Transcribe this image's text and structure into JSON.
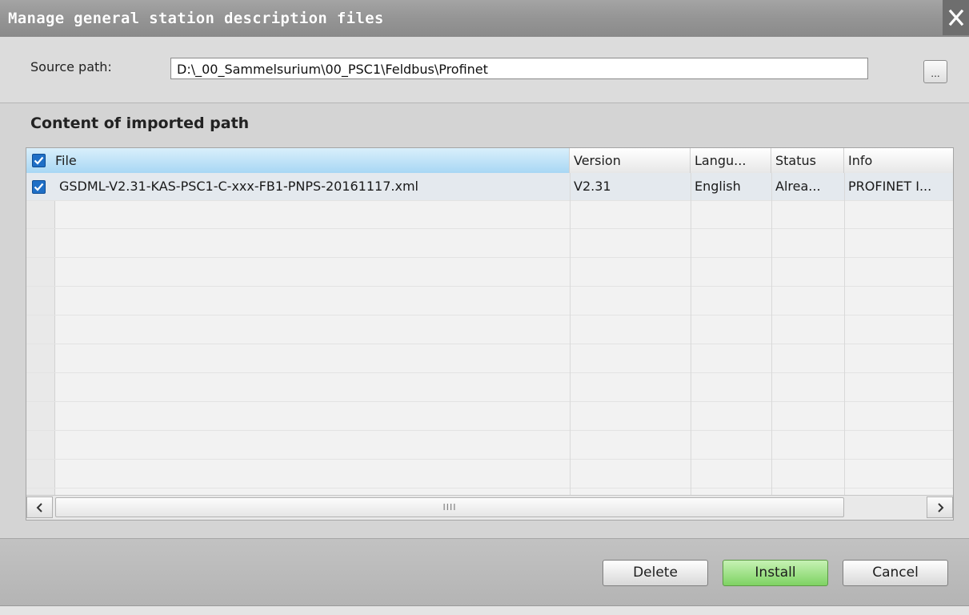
{
  "window": {
    "title": "Manage general station description files"
  },
  "source": {
    "label": "Source path:",
    "value": "D:\\_00_Sammelsurium\\00_PSC1\\Feldbus\\Profinet",
    "browse_label": "..."
  },
  "content": {
    "heading": "Content of imported path"
  },
  "table": {
    "columns": {
      "file": "File",
      "version": "Version",
      "language": "Langu...",
      "status": "Status",
      "info": "Info"
    },
    "select_all_checked": true,
    "rows": [
      {
        "checked": true,
        "file": "GSDML-V2.31-KAS-PSC1-C-xxx-FB1-PNPS-20161117.xml",
        "version": "V2.31",
        "language": "English",
        "status": "Alrea...",
        "info": "PROFINET I..."
      }
    ],
    "scrollbar_thumb": "IIII"
  },
  "buttons": {
    "delete": "Delete",
    "install": "Install",
    "cancel": "Cancel"
  },
  "colors": {
    "install_button": "#7ed263",
    "header_highlight": "#a8d7f4",
    "checkbox": "#1f6fc6"
  },
  "icons": {
    "close": "close-icon",
    "checkbox": "checkmark-icon",
    "scroll_left": "chevron-left-icon",
    "scroll_right": "chevron-right-icon"
  }
}
